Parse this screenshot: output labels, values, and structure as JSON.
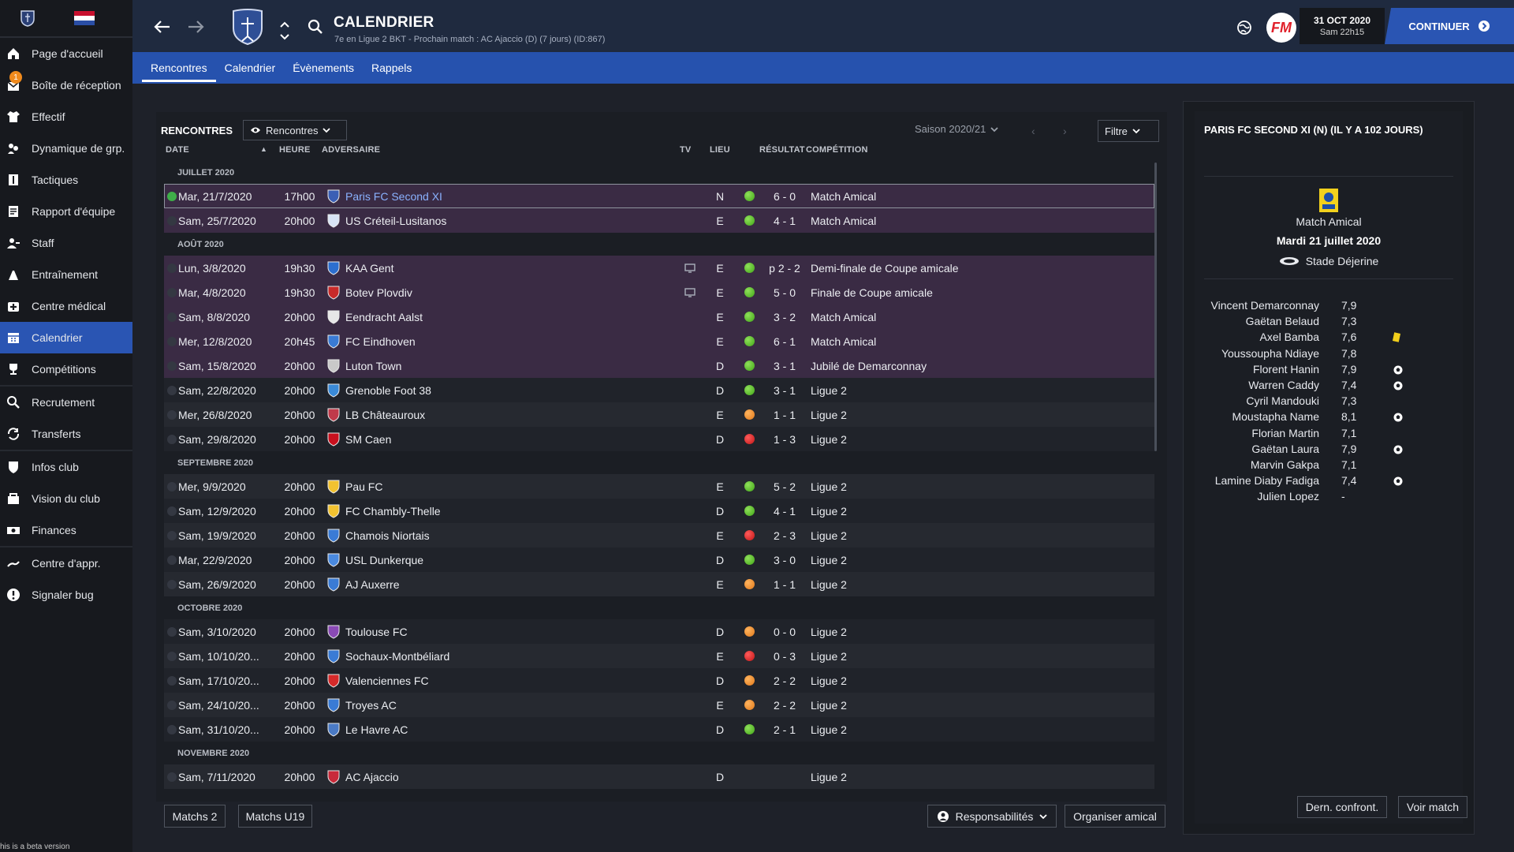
{
  "sidebar": {
    "items": [
      {
        "label": "Page d'accueil",
        "icon": "home-icon"
      },
      {
        "label": "Boîte de réception",
        "icon": "inbox-icon",
        "badge": "1"
      },
      {
        "label": "Effectif",
        "icon": "shirt-icon"
      },
      {
        "label": "Dynamique de grp.",
        "icon": "group-dynamics-icon"
      },
      {
        "label": "Tactiques",
        "icon": "tactics-icon"
      },
      {
        "label": "Rapport d'équipe",
        "icon": "report-icon"
      },
      {
        "label": "Staff",
        "icon": "staff-icon"
      },
      {
        "label": "Entraînement",
        "icon": "training-icon"
      },
      {
        "label": "Centre médical",
        "icon": "medical-icon"
      },
      {
        "label": "Calendrier",
        "icon": "calendar-icon"
      },
      {
        "label": "Compétitions",
        "icon": "trophy-icon"
      },
      {
        "label": "Recrutement",
        "icon": "search-icon"
      },
      {
        "label": "Transferts",
        "icon": "transfer-icon"
      },
      {
        "label": "Infos club",
        "icon": "shield-icon"
      },
      {
        "label": "Vision du club",
        "icon": "vision-icon"
      },
      {
        "label": "Finances",
        "icon": "money-icon"
      },
      {
        "label": "Centre d'appr.",
        "icon": "academy-icon"
      },
      {
        "label": "Signaler bug",
        "icon": "bug-icon"
      }
    ],
    "beta_text": "his is a beta version"
  },
  "header": {
    "title": "CALENDRIER",
    "subtitle": "7e en Ligue 2 BKT - Prochain match : AC Ajaccio (D) (7 jours) (ID:867)",
    "date": "31 OCT 2020",
    "time": "Sam 22h15",
    "continue_label": "CONTINUER",
    "fm_logo": "FM"
  },
  "tabs": [
    "Rencontres",
    "Calendrier",
    "Évènements",
    "Rappels"
  ],
  "panel": {
    "title": "RENCONTRES",
    "view_dropdown": "Rencontres",
    "season": "Saison 2020/21",
    "filter": "Filtre",
    "columns": {
      "date": "DATE",
      "heure": "HEURE",
      "adversaire": "ADVERSAIRE",
      "tv": "TV",
      "lieu": "LIEU",
      "resultat": "RÉSULTAT",
      "competition": "COMPÉTITION"
    }
  },
  "months": {
    "jul": "JUILLET 2020",
    "aug": "AOÛT 2020",
    "sep": "SEPTEMBRE 2020",
    "oct": "OCTOBRE 2020",
    "nov": "NOVEMBRE 2020"
  },
  "matches": [
    {
      "date": "Mar, 21/7/2020",
      "time": "17h00",
      "opponent": "Paris FC Second XI",
      "tv": false,
      "venue": "N",
      "outcome": "win",
      "score": "6 - 0",
      "competition": "Match Amical",
      "type": "friendly",
      "selected": true
    },
    {
      "date": "Sam, 25/7/2020",
      "time": "20h00",
      "opponent": "US Créteil-Lusitanos",
      "tv": false,
      "venue": "E",
      "outcome": "win",
      "score": "4 - 1",
      "competition": "Match Amical",
      "type": "friendly"
    },
    {
      "date": "Lun, 3/8/2020",
      "time": "19h30",
      "opponent": "KAA Gent",
      "tv": true,
      "venue": "E",
      "outcome": "win",
      "score": "p 2 - 2",
      "competition": "Demi-finale de Coupe amicale",
      "type": "friendly"
    },
    {
      "date": "Mar, 4/8/2020",
      "time": "19h30",
      "opponent": "Botev Plovdiv",
      "tv": true,
      "venue": "E",
      "outcome": "win",
      "score": "5 - 0",
      "competition": "Finale de Coupe amicale",
      "type": "friendly"
    },
    {
      "date": "Sam, 8/8/2020",
      "time": "20h00",
      "opponent": "Eendracht Aalst",
      "tv": false,
      "venue": "E",
      "outcome": "win",
      "score": "3 - 2",
      "competition": "Match Amical",
      "type": "friendly"
    },
    {
      "date": "Mer, 12/8/2020",
      "time": "20h45",
      "opponent": "FC Eindhoven",
      "tv": false,
      "venue": "E",
      "outcome": "win",
      "score": "6 - 1",
      "competition": "Match Amical",
      "type": "friendly"
    },
    {
      "date": "Sam, 15/8/2020",
      "time": "20h00",
      "opponent": "Luton Town",
      "tv": false,
      "venue": "D",
      "outcome": "win",
      "score": "3 - 1",
      "competition": "Jubilé de Demarconnay",
      "type": "friendly"
    },
    {
      "date": "Sam, 22/8/2020",
      "time": "20h00",
      "opponent": "Grenoble Foot 38",
      "tv": false,
      "venue": "D",
      "outcome": "win",
      "score": "3 - 1",
      "competition": "Ligue 2",
      "type": "league"
    },
    {
      "date": "Mer, 26/8/2020",
      "time": "20h00",
      "opponent": "LB Châteauroux",
      "tv": false,
      "venue": "E",
      "outcome": "draw",
      "score": "1 - 1",
      "competition": "Ligue 2",
      "type": "league"
    },
    {
      "date": "Sam, 29/8/2020",
      "time": "20h00",
      "opponent": "SM Caen",
      "tv": false,
      "venue": "D",
      "outcome": "loss",
      "score": "1 - 3",
      "competition": "Ligue 2",
      "type": "league"
    },
    {
      "date": "Mer, 9/9/2020",
      "time": "20h00",
      "opponent": "Pau FC",
      "tv": false,
      "venue": "E",
      "outcome": "win",
      "score": "5 - 2",
      "competition": "Ligue 2",
      "type": "league"
    },
    {
      "date": "Sam, 12/9/2020",
      "time": "20h00",
      "opponent": "FC Chambly-Thelle",
      "tv": false,
      "venue": "D",
      "outcome": "win",
      "score": "4 - 1",
      "competition": "Ligue 2",
      "type": "league"
    },
    {
      "date": "Sam, 19/9/2020",
      "time": "20h00",
      "opponent": "Chamois Niortais",
      "tv": false,
      "venue": "E",
      "outcome": "loss",
      "score": "2 - 3",
      "competition": "Ligue 2",
      "type": "league"
    },
    {
      "date": "Mar, 22/9/2020",
      "time": "20h00",
      "opponent": "USL Dunkerque",
      "tv": false,
      "venue": "D",
      "outcome": "win",
      "score": "3 - 0",
      "competition": "Ligue 2",
      "type": "league"
    },
    {
      "date": "Sam, 26/9/2020",
      "time": "20h00",
      "opponent": "AJ Auxerre",
      "tv": false,
      "venue": "E",
      "outcome": "draw",
      "score": "1 - 1",
      "competition": "Ligue 2",
      "type": "league"
    },
    {
      "date": "Sam, 3/10/2020",
      "time": "20h00",
      "opponent": "Toulouse FC",
      "tv": false,
      "venue": "D",
      "outcome": "draw",
      "score": "0 - 0",
      "competition": "Ligue 2",
      "type": "league"
    },
    {
      "date": "Sam, 10/10/20...",
      "time": "20h00",
      "opponent": "Sochaux-Montbéliard",
      "tv": false,
      "venue": "E",
      "outcome": "loss",
      "score": "0 - 3",
      "competition": "Ligue 2",
      "type": "league"
    },
    {
      "date": "Sam, 17/10/20...",
      "time": "20h00",
      "opponent": "Valenciennes FC",
      "tv": false,
      "venue": "D",
      "outcome": "draw",
      "score": "2 - 2",
      "competition": "Ligue 2",
      "type": "league"
    },
    {
      "date": "Sam, 24/10/20...",
      "time": "20h00",
      "opponent": "Troyes AC",
      "tv": false,
      "venue": "E",
      "outcome": "draw",
      "score": "2 - 2",
      "competition": "Ligue 2",
      "type": "league"
    },
    {
      "date": "Sam, 31/10/20...",
      "time": "20h00",
      "opponent": "Le Havre AC",
      "tv": false,
      "venue": "D",
      "outcome": "win",
      "score": "2 - 1",
      "competition": "Ligue 2",
      "type": "league"
    },
    {
      "date": "Sam, 7/11/2020",
      "time": "20h00",
      "opponent": "AC Ajaccio",
      "tv": false,
      "venue": "D",
      "outcome": "none",
      "score": "",
      "competition": "Ligue 2",
      "type": "league"
    }
  ],
  "bottom_buttons": {
    "matchs2": "Matchs 2",
    "matchsu19": "Matchs U19",
    "responsabilites": "Responsabilités",
    "organiser": "Organiser amical"
  },
  "details": {
    "title": "PARIS FC SECOND XI (N) (IL Y A 102 JOURS)",
    "competition": "Match Amical",
    "date": "Mardi 21 juillet 2020",
    "stadium": "Stade Déjerine",
    "players": [
      {
        "name": "Vincent Demarconnay",
        "rating": "7,9",
        "icon": ""
      },
      {
        "name": "Gaëtan Belaud",
        "rating": "7,3",
        "icon": ""
      },
      {
        "name": "Axel Bamba",
        "rating": "7,6",
        "icon": "yellow-card-icon"
      },
      {
        "name": "Youssoupha Ndiaye",
        "rating": "7,8",
        "icon": ""
      },
      {
        "name": "Florent Hanin",
        "rating": "7,9",
        "icon": "ball-icon"
      },
      {
        "name": "Warren Caddy",
        "rating": "7,4",
        "icon": "ball-icon"
      },
      {
        "name": "Cyril Mandouki",
        "rating": "7,3",
        "icon": ""
      },
      {
        "name": "Moustapha Name",
        "rating": "8,1",
        "icon": "ball-icon"
      },
      {
        "name": "Florian Martin",
        "rating": "7,1",
        "icon": ""
      },
      {
        "name": "Gaëtan Laura",
        "rating": "7,9",
        "icon": "ball-icon"
      },
      {
        "name": "Marvin Gakpa",
        "rating": "7,1",
        "icon": ""
      },
      {
        "name": "Lamine Diaby Fadiga",
        "rating": "7,4",
        "icon": "ball-icon"
      },
      {
        "name": "Julien Lopez",
        "rating": "-",
        "icon": ""
      }
    ],
    "btn_last": "Dern. confront.",
    "btn_view": "Voir match"
  },
  "colors": {
    "accent": "#2a55b3",
    "friendly_row": "#3a2b44",
    "win": "#41a617",
    "draw": "#e0781a",
    "loss": "#c01616"
  }
}
